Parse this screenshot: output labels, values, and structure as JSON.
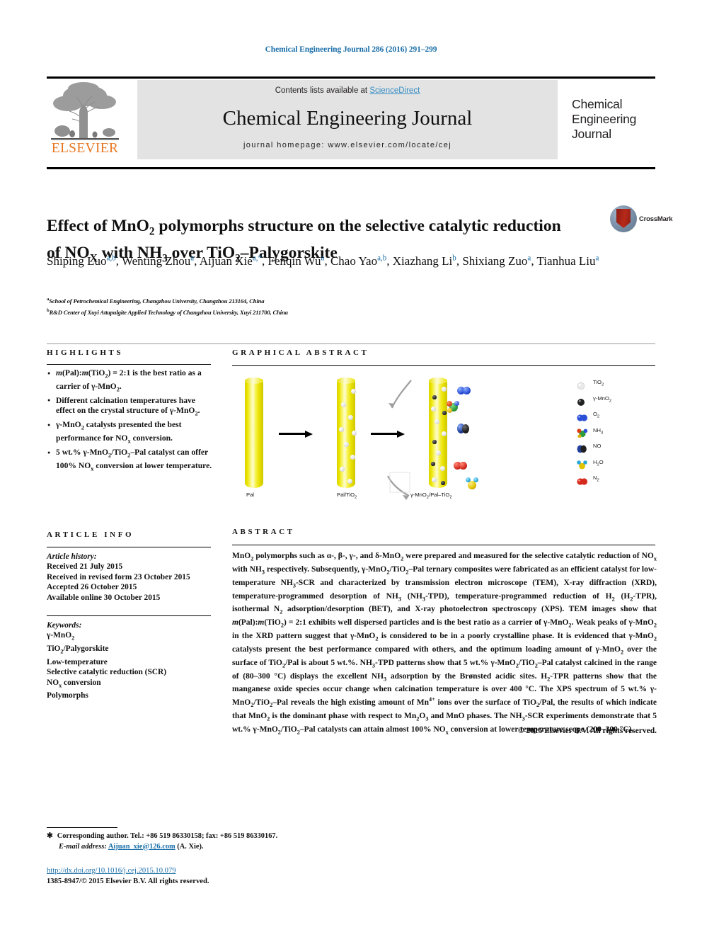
{
  "running_head": "Chemical Engineering Journal 286 (2016) 291–299",
  "masthead": {
    "contents_prefix": "Contents lists available at ",
    "sciencedirect": "ScienceDirect",
    "journal_title": "Chemical Engineering Journal",
    "homepage": "journal homepage: www.elsevier.com/locate/cej",
    "publisher_wordmark": "ELSEVIER",
    "cover_logo_lines": [
      "Chemical",
      "Engineering",
      "Journal"
    ]
  },
  "article": {
    "title_line1_a": "Effect of MnO",
    "title_line1_sub": "2",
    "title_line1_b": " polymorphs structure on the selective catalytic reduction",
    "title_line2_a": "of NO",
    "title_line2_subx": "X",
    "title_line2_b": " with NH",
    "title_line2_sub3": "3",
    "title_line2_c": " over TiO",
    "title_line2_sub2": "2",
    "title_line2_d": "–Palygorskite",
    "crossmark_label": "CrossMark",
    "authors": [
      {
        "name": "Shiping Luo",
        "marks": "a,b",
        "sep": ", "
      },
      {
        "name": "Wenting Zhou",
        "marks": "a",
        "sep": ", "
      },
      {
        "name": "Aijuan Xie",
        "marks": "a,*",
        "sep": ", "
      },
      {
        "name": "Fenqin Wu",
        "marks": "a",
        "sep": ", "
      },
      {
        "name": "Chao Yao",
        "marks": "a,b",
        "sep": ", "
      },
      {
        "name": "Xiazhang Li",
        "marks": "b",
        "sep": ", "
      },
      {
        "name": "Shixiang Zuo",
        "marks": "a",
        "sep": ", "
      },
      {
        "name": "Tianhua Liu",
        "marks": "a",
        "sep": ""
      }
    ],
    "affiliations": [
      {
        "mark": "a",
        "text": "School of Petrochemical Engineering, Changzhou University, Changzhou 213164, China"
      },
      {
        "mark": "b",
        "text": "R&D Center of Xuyi Attapulgite Applied Technology of Changzhou University, Xuyi 211700, China"
      }
    ]
  },
  "highlights": {
    "heading": "HIGHLIGHTS",
    "items": [
      "m(Pal):m(TiO2) = 2:1 is the best ratio as a carrier of γ-MnO2.",
      "Different calcination temperatures have effect on the crystal structure of γ-MnO2.",
      "γ-MnO2 catalysts presented the best performance for NOx conversion.",
      "5 wt.% γ-MnO2/TiO2–Pal catalyst can offer 100% NOx conversion at lower temperature."
    ]
  },
  "article_info": {
    "heading": "ARTICLE INFO",
    "history_label": "Article history:",
    "history": [
      "Received 21 July 2015",
      "Received in revised form 23 October 2015",
      "Accepted 26 October 2015",
      "Available online 30 October 2015"
    ],
    "keywords_label": "Keywords:",
    "keywords": [
      "γ-MnO2",
      "TiO2/Palygorskite",
      "Low-temperature",
      "Selective catalytic reduction (SCR)",
      "NOx conversion",
      "Polymorphs"
    ]
  },
  "graphical_abstract": {
    "heading": "GRAPHICAL ABSTRACT",
    "stage_labels": [
      "Pal",
      "Pal/TiO2",
      "γ-MnO2/Pal–TiO2"
    ],
    "legend": [
      {
        "icon": "white-sphere-icon",
        "label": "TiO2",
        "color": "#e9e9e9"
      },
      {
        "icon": "black-sphere-icon",
        "label": "γ-MnO2",
        "color": "#222222"
      },
      {
        "icon": "blue-diatomic-icon",
        "label": "O2",
        "color": "#1f3fd0"
      },
      {
        "icon": "ammonia-molecule-icon",
        "label": "NH3",
        "color": "#2e9b3f"
      },
      {
        "icon": "no-molecule-icon",
        "label": "NO",
        "color": "#1b3a8a"
      },
      {
        "icon": "water-molecule-icon",
        "label": "H2O",
        "color": "#e2c300"
      },
      {
        "icon": "red-diatomic-icon",
        "label": "N2",
        "color": "#d52b1e"
      }
    ]
  },
  "abstract": {
    "heading": "ABSTRACT",
    "paragraph": "MnO2 polymorphs such as α-, β-, γ-, and δ-MnO2 were prepared and measured for the selective catalytic reduction of NOx with NH3 respectively. Subsequently, γ-MnO2/TiO2–Pal ternary composites were fabricated as an efficient catalyst for low-temperature NH3-SCR and characterized by transmission electron microscope (TEM), X-ray diffraction (XRD), temperature-programmed desorption of NH3 (NH3-TPD), temperature-programmed reduction of H2 (H2-TPR), isothermal N2 adsorption/desorption (BET), and X-ray photoelectron spectroscopy (XPS). TEM images show that m(Pal):m(TiO2) = 2:1 exhibits well dispersed particles and is the best ratio as a carrier of γ-MnO2. Weak peaks of γ-MnO2 in the XRD pattern suggest that γ-MnO2 is considered to be in a poorly crystalline phase. It is evidenced that γ-MnO2 catalysts present the best performance compared with others, and the optimum loading amount of γ-MnO2 over the surface of TiO2/Pal is about 5 wt.%. NH3-TPD patterns show that 5 wt.% γ-MnO2/TiO2–Pal catalyst calcined in the range of (80–300 °C) displays the excellent NH3 adsorption by the Brønsted acidic sites. H2-TPR patterns show that the manganese oxide species occur change when calcination temperature is over 400 °C. The XPS spectrum of 5 wt.% γ-MnO2/TiO2–Pal reveals the high existing amount of Mn4+ ions over the surface of TiO2/Pal, the results of which indicate that MnO2 is the dominant phase with respect to Mn2O3 and MnO phases. The NH3-SCR experiments demonstrate that 5 wt.% γ-MnO2/TiO2–Pal catalysts can attain almost 100% NOx conversion at lower temperature scope (200–300 °C).",
    "copyright": "© 2015 Elsevier B.V. All rights reserved."
  },
  "footnotes": {
    "corresponding": "Corresponding author. Tel.: +86 519 86330158; fax: +86 519 86330167.",
    "email_label": "E-mail address:",
    "email": "Aijuan_xie@126.com",
    "email_owner": "(A. Xie).",
    "doi": "http://dx.doi.org/10.1016/j.cej.2015.10.079",
    "issn_line": "1385-8947/© 2015 Elsevier B.V. All rights reserved."
  },
  "colors": {
    "link": "#1a6ea8",
    "elsevier_orange": "#e87722",
    "band_grey": "#e3e3e3"
  }
}
